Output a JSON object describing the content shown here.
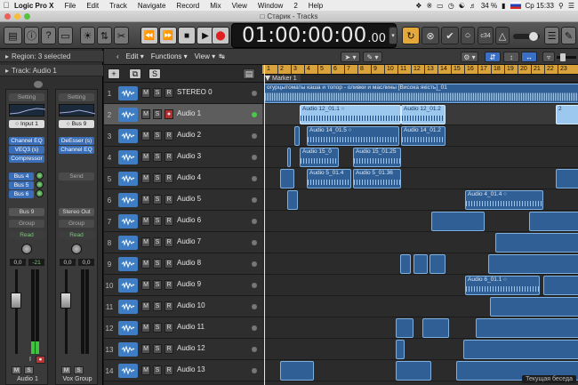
{
  "menubar": {
    "app": "Logic Pro X",
    "items": [
      "File",
      "Edit",
      "Track",
      "Navigate",
      "Record",
      "Mix",
      "View",
      "Window",
      "2",
      "Help"
    ],
    "battery": "34 %",
    "clock": "Ср 15:33"
  },
  "window": {
    "title": "Старик - Tracks"
  },
  "transport": {
    "time_main": "01:00:00:00",
    "time_frac": ".00",
    "key": "c34"
  },
  "inspector": {
    "region": "Region: 3 selected",
    "track": "Track:  Audio 1",
    "strip1": {
      "setting": "Setting",
      "input": "Input 1",
      "plugins": [
        "Channel EQ",
        "VEQ3 (s)",
        "Compressor"
      ],
      "sends": [
        "Bus 4",
        "Bus 5",
        "Bus 6"
      ],
      "output": "Bus 9",
      "group": "Group",
      "automation": "Read",
      "volume": "0,0",
      "peak": "-21",
      "name": "Audio 1"
    },
    "strip2": {
      "setting": "Setting",
      "input": "Bus 9",
      "plugins": [
        "DeEsser (s)",
        "Channel EQ"
      ],
      "send": "Send",
      "output": "Stereo Out",
      "group": "Group",
      "automation": "Read",
      "volume": "0,0",
      "peak": "0,0",
      "name": "Vox Group"
    }
  },
  "tracks_toolbar": {
    "edit": "Edit",
    "functions": "Functions",
    "view": "View"
  },
  "marker": "Marker 1",
  "ruler": [
    "1",
    "2",
    "3",
    "4",
    "5",
    "6",
    "7",
    "8",
    "9",
    "10",
    "11",
    "12",
    "13",
    "14",
    "15",
    "16",
    "17",
    "18",
    "19",
    "20",
    "21",
    "22",
    "23"
  ],
  "tracks": [
    {
      "num": "1",
      "name": "STEREO 0"
    },
    {
      "num": "2",
      "name": "Audio 1",
      "selected": true
    },
    {
      "num": "3",
      "name": "Audio 2"
    },
    {
      "num": "4",
      "name": "Audio 3"
    },
    {
      "num": "5",
      "name": "Audio 4"
    },
    {
      "num": "6",
      "name": "Audio 5"
    },
    {
      "num": "7",
      "name": "Audio 6"
    },
    {
      "num": "8",
      "name": "Audio 7"
    },
    {
      "num": "9",
      "name": "Audio 8"
    },
    {
      "num": "10",
      "name": "Audio 9"
    },
    {
      "num": "11",
      "name": "Audio 10"
    },
    {
      "num": "12",
      "name": "Audio 11"
    },
    {
      "num": "13",
      "name": "Audio 12"
    },
    {
      "num": "14",
      "name": "Audio 13"
    }
  ],
  "regions": {
    "stereo": "огурцытоматы каша и топор - оливки и маслины [Висока якість]_01",
    "a12_1": "Audio 12_01.1",
    "a12_2": "Audio 12_01.2",
    "a14_1": "Audio 14_01.5",
    "a14_2": "Audio 14_01.2",
    "a15_1": "Audio 15_0",
    "a15_2": "Audio 15_01.25",
    "a5_1": "Audio 5_01.4",
    "a5_2": "Audio 5_01.36",
    "a4": "Audio 4_01.4",
    "a6": "Audio 6_01.1"
  },
  "tooltip": "Текущая беседа"
}
